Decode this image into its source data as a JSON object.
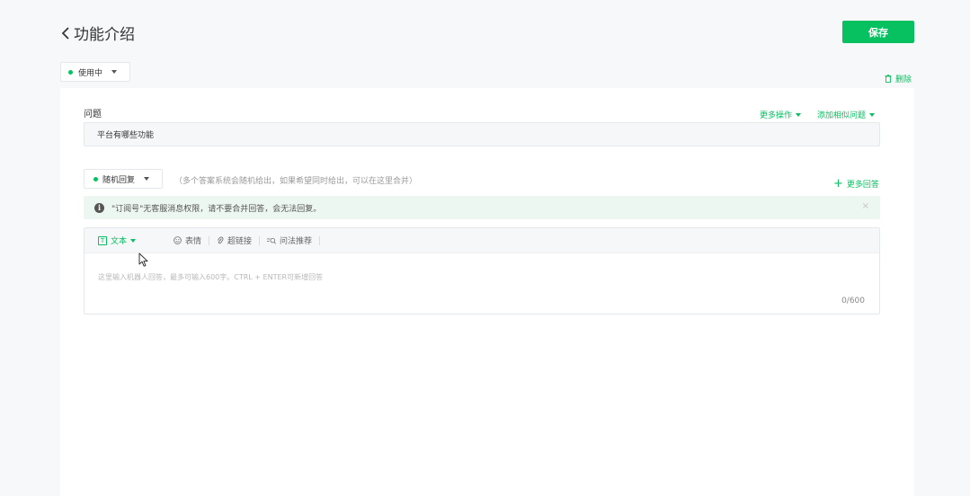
{
  "header": {
    "title": "功能介绍",
    "save_label": "保存"
  },
  "status": {
    "label": "使用中",
    "color": "#07c160"
  },
  "actions": {
    "delete_label": "删除"
  },
  "question": {
    "label": "问题",
    "more_ops_label": "更多操作",
    "add_similar_label": "添加相似问题",
    "value": "平台有哪些功能"
  },
  "answer": {
    "mode_label": "随机回复",
    "mode_hint": "（多个答案系统会随机给出，如果希望同时给出，可以在这里合并）",
    "more_answers_label": "更多回答",
    "notice": "\"订阅号\"无客服消息权限，请不要合并回答，会无法回复。",
    "toolbar": {
      "text_label": "文本",
      "emoji_label": "表情",
      "link_label": "超链接",
      "recommend_label": "问法推荐"
    },
    "placeholder": "这里输入机器人回答，最多可输入600字。CTRL + ENTER可新增回答",
    "counter": "0/600"
  },
  "icons": {
    "back": "chevron-left-icon",
    "delete": "trash-icon",
    "info": "info-icon",
    "close": "close-icon",
    "text": "text-format-icon",
    "emoji": "smiley-icon",
    "link": "paperclip-icon",
    "recommend": "search-text-icon",
    "cursor": "mouse-pointer-icon"
  },
  "accent_color": "#07c160"
}
